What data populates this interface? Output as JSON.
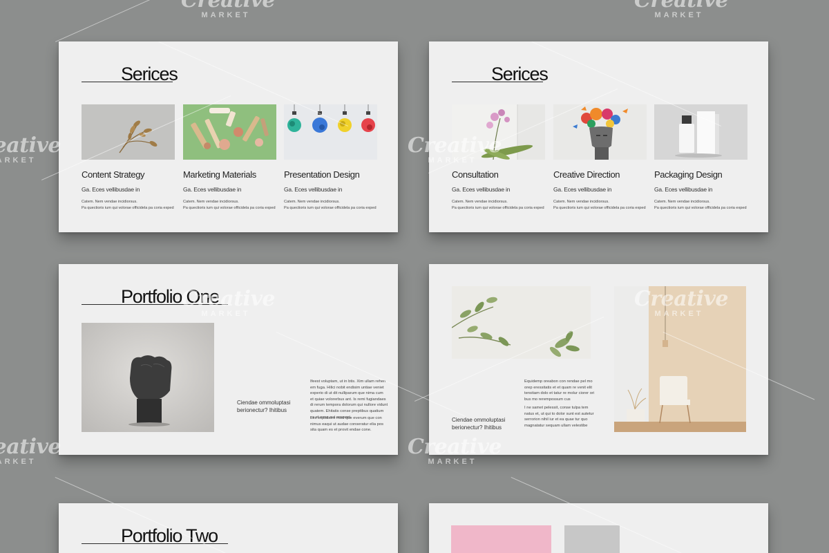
{
  "watermark": {
    "word": "Creative",
    "sub": "MARKET"
  },
  "slides": {
    "s1": {
      "title": "Serices",
      "cards": [
        {
          "title": "Content Strategy",
          "sub": "Ga. Eces vellibusdae in",
          "desc1": "Catem. Nem vendae incidiorsus.",
          "desc2": "Pa quectioris ium qui volorae officidela pa coria exped"
        },
        {
          "title": "Marketing Materials",
          "sub": "Ga. Eces vellibusdae in",
          "desc1": "Catem. Nem vendae incidiorsus.",
          "desc2": "Pa quectioris ium qui volorae officidela pa coria exped"
        },
        {
          "title": "Presentation Design",
          "sub": "Ga. Eces vellibusdae in",
          "desc1": "Catem. Nem vendae incidiorsus.",
          "desc2": "Pa quectioris ium qui volorae officidela pa coria exped"
        }
      ]
    },
    "s2": {
      "title": "Serices",
      "cards": [
        {
          "title": "Consultation",
          "sub": "Ga. Eces vellibusdae in",
          "desc1": "Catem. Nem vendae incidiorsus.",
          "desc2": "Pa quectioris ium qui volorae officidela pa coria exped"
        },
        {
          "title": "Creative Direction",
          "sub": "Ga. Eces vellibusdae in",
          "desc1": "Catem. Nem vendae incidiorsus.",
          "desc2": "Pa quectioris ium qui volorae officidela pa coria exped"
        },
        {
          "title": "Packaging Design",
          "sub": "Ga. Eces vellibusdae in",
          "desc1": "Catem. Nem vendae incidiorsus.",
          "desc2": "Pa quectioris ium qui volorae officidela pa coria exped"
        }
      ]
    },
    "s3": {
      "title": "Portfolio One",
      "quote1": "Ciendae ommoluptasi",
      "quote2": "berionectur? Ihitibus",
      "para1": [
        "Ifeest voluptam, ut in btis. Xim ullam rehen",
        "em fuga. Hilici nobit endisim untiae veniet",
        "experio di ut dit nulliparum que nima cum",
        "et quiae volorerbus ant. Is remi fugiandaes",
        "di rerum tempora dolorum qui nullore vidunt",
        "quatem. Ehitatis conse preptibus quatium",
        "es et esse aut eossent."
      ],
      "para2": [
        "Les explabore mod que everum que con",
        "nimus eaqui ut audae conseratur elia pos",
        "sita quam es et provit endae cone."
      ]
    },
    "s4": {
      "quote1": "Ciendae ommoluptasi",
      "quote2": "berionectur? Ihitibus",
      "para1": [
        "Equidemp oreabon con rendae pel mo",
        "orep eressitatis et et quam re venit elit",
        "tenstiam dolo et tatur re molur ciorer ori",
        "bus mo rerempossum cus"
      ],
      "para2": [
        "I ne samet pelessit, conse tulpa tem",
        "natus et, ut qui to dolor sunt est autetur",
        "serrorion nihil iur et ea quae tur quo",
        "magnatatur sequam ullam velestibe"
      ]
    },
    "s5": {
      "title": "Portfolio Two"
    }
  }
}
